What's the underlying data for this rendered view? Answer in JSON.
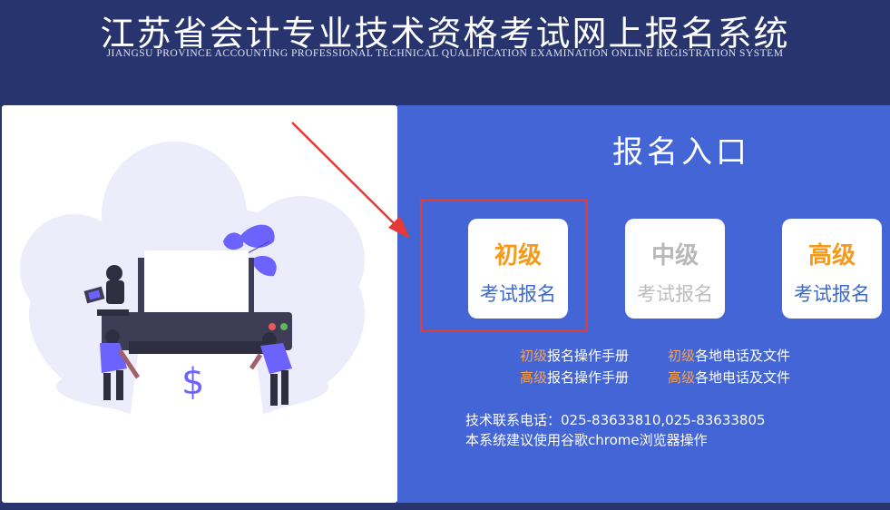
{
  "header": {
    "title_cn": "江苏省会计专业技术资格考试网上报名系统",
    "title_en": "JIANGSU PROVINCE ACCOUNTING PROFESSIONAL TECHNICAL QUALIFICATION EXAMINATION ONLINE REGISTRATION SYSTEM"
  },
  "entry": {
    "title": "报名入口",
    "cards": [
      {
        "level": "初级",
        "action": "考试报名",
        "state": "active"
      },
      {
        "level": "中级",
        "action": "考试报名",
        "state": "disabled"
      },
      {
        "level": "高级",
        "action": "考试报名",
        "state": "active"
      }
    ]
  },
  "links": {
    "junior_manual": {
      "prefix": "初级",
      "text": "报名操作手册"
    },
    "junior_files": {
      "prefix": "初级",
      "text": "各地电话及文件"
    },
    "senior_manual": {
      "prefix": "高级",
      "text": "报名操作手册"
    },
    "senior_files": {
      "prefix": "高级",
      "text": "各地电话及文件"
    }
  },
  "info": {
    "phone": "技术联系电话：025-83633810,025-83633805",
    "browser_tip": "本系统建议使用谷歌chrome浏览器操作"
  },
  "illustration": {
    "symbol": "$"
  },
  "colors": {
    "header_bg": "#27346e",
    "panel_bg": "#4465d6",
    "accent_orange": "#f39a1c",
    "action_blue": "#3e68c9",
    "highlight_red": "#e53935",
    "illustration_purple": "#6c63ff"
  }
}
